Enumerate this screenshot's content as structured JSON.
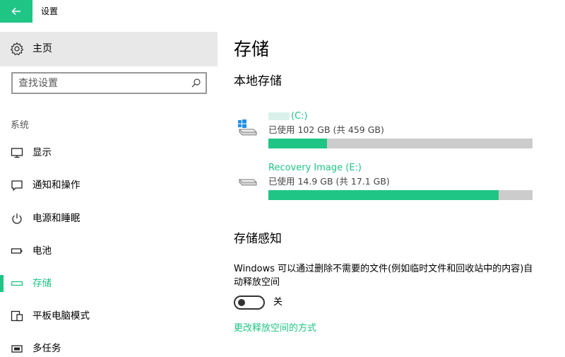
{
  "window": {
    "title": "设置"
  },
  "colors": {
    "accent": "#1fc585",
    "sidebar_home_bg": "#e8e8e8",
    "bar_track": "#cccccc"
  },
  "sidebar": {
    "home_label": "主页",
    "search_placeholder": "查找设置",
    "section_label": "系统",
    "items": [
      {
        "label": "显示",
        "icon": "monitor-icon"
      },
      {
        "label": "通知和操作",
        "icon": "notification-icon"
      },
      {
        "label": "电源和睡眠",
        "icon": "power-icon"
      },
      {
        "label": "电池",
        "icon": "battery-icon"
      },
      {
        "label": "存储",
        "icon": "storage-icon",
        "active": true
      },
      {
        "label": "平板电脑模式",
        "icon": "tablet-mode-icon"
      },
      {
        "label": "多任务",
        "icon": "multitasking-icon"
      }
    ]
  },
  "main": {
    "title": "存储",
    "local_storage_heading": "本地存储",
    "drives": [
      {
        "name": "(C:)",
        "usage_text": "已使用 102 GB (共 459 GB)",
        "used_fraction": 0.222,
        "icon": "windows-drive-icon"
      },
      {
        "name": "Recovery Image (E:)",
        "usage_text": "已使用 14.9 GB (共 17.1 GB)",
        "used_fraction": 0.871,
        "icon": "drive-icon"
      }
    ],
    "storage_sense_heading": "存储感知",
    "storage_sense_desc": "Windows 可以通过删除不需要的文件(例如临时文件和回收站中的内容)自动释放空间",
    "toggle": {
      "state_label": "关",
      "on": false
    },
    "change_link": "更改释放空间的方式"
  }
}
